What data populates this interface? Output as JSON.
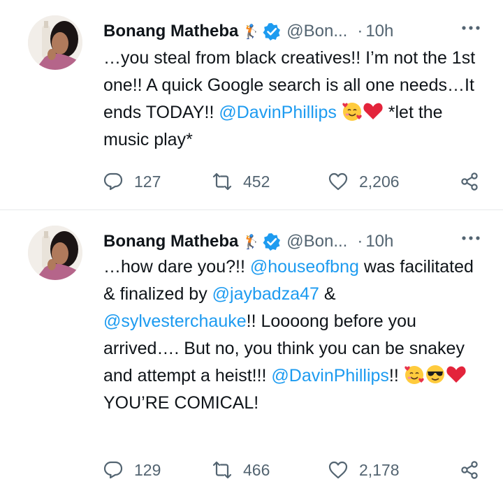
{
  "tweets": [
    {
      "name": "Bonang Matheba",
      "name_emoji": "🏌",
      "handle": "@Bon...",
      "separator": "·",
      "time": "10h",
      "text_parts": [
        "…you steal from black creatives!! I’m not the 1st one!! A quick Google search is all one needs…It ends TODAY!! ",
        "@DavinPhillips",
        " *let the music play*"
      ],
      "emojis": [
        "smiling-face-with-hearts",
        "red-heart"
      ],
      "stats": {
        "replies": "127",
        "retweets": "452",
        "likes": "2,206"
      }
    },
    {
      "name": "Bonang Matheba",
      "name_emoji": "🏌",
      "handle": "@Bon...",
      "separator": "·",
      "time": "10h",
      "segments": {
        "s1": "…how dare you?!! ",
        "m1": "@houseofbng",
        "s2": " was facilitated & finalized by ",
        "m2": "@jaybadza47",
        "s3": " & ",
        "m3": "@sylvesterchauke",
        "s4": "!! Loooong before you arrived…. But no, you think you can be snakey and attempt a heist!!! ",
        "m4": "@DavinPhillips",
        "s5": "!! ",
        "s6": " YOU’RE COMICAL!"
      },
      "emojis": [
        "smiling-face-with-hearts",
        "smiling-face-with-sunglasses",
        "red-heart"
      ],
      "stats": {
        "replies": "129",
        "retweets": "466",
        "likes": "2,178"
      }
    }
  ],
  "colors": {
    "link": "#1d9bf0",
    "muted": "#536471",
    "verified": "#1d9bf0"
  }
}
